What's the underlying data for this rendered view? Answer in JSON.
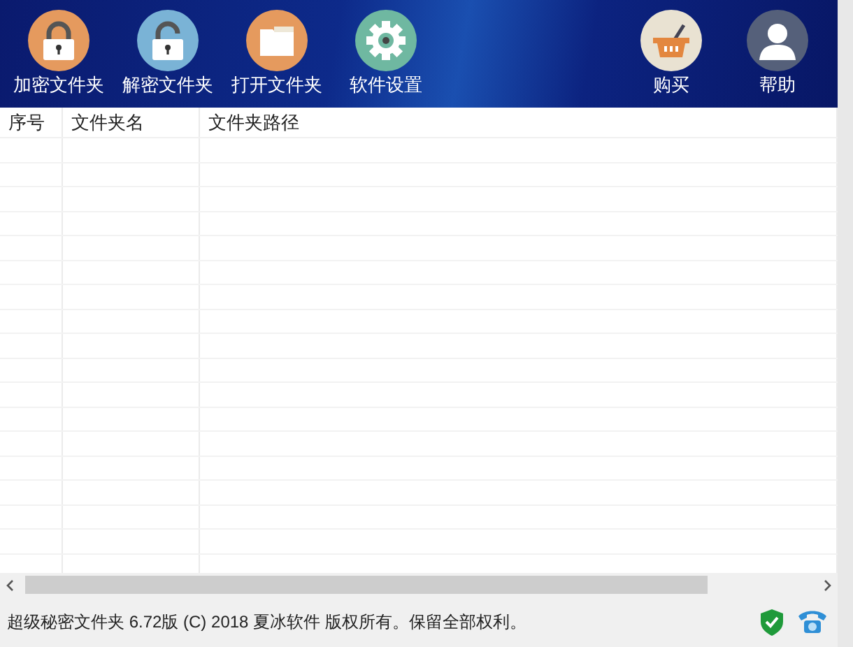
{
  "toolbar_left": [
    {
      "label": "加密文件夹",
      "kind": "lock"
    },
    {
      "label": "解密文件夹",
      "kind": "unlock"
    },
    {
      "label": "打开文件夹",
      "kind": "folder"
    },
    {
      "label": "软件设置",
      "kind": "gear"
    }
  ],
  "toolbar_right": [
    {
      "label": "购买",
      "kind": "basket"
    },
    {
      "label": "帮助",
      "kind": "person"
    }
  ],
  "table": {
    "columns": [
      "序号",
      "文件夹名",
      "文件夹路径"
    ]
  },
  "status_bar": {
    "text": "超级秘密文件夹 6.72版 (C) 2018 夏冰软件 版权所有。保留全部权利。"
  }
}
